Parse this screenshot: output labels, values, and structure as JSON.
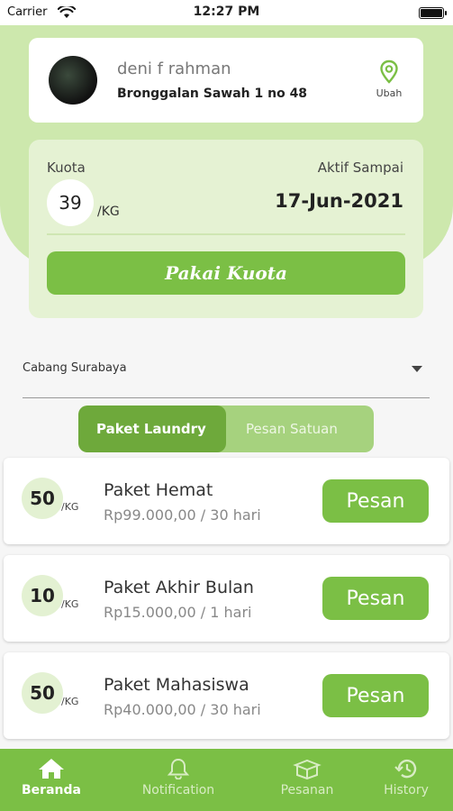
{
  "status_bar": {
    "carrier": "Carrier",
    "time": "12:27 PM"
  },
  "profile": {
    "name": "deni f rahman",
    "address": "Bronggalan Sawah 1 no 48",
    "location_label": "Ubah"
  },
  "quota": {
    "label": "Kuota",
    "value": "39",
    "unit": "/KG",
    "active_label": "Aktif Sampai",
    "active_date": "17-Jun-2021",
    "button_label": "Pakai Kuota"
  },
  "branch": {
    "selected": "Cabang Surabaya"
  },
  "tabs": [
    {
      "label": "Paket Laundry",
      "active": true
    },
    {
      "label": "Pesan Satuan",
      "active": false
    }
  ],
  "packages": [
    {
      "kg": "50",
      "unit": "/KG",
      "name": "Paket Hemat",
      "price": "Rp99.000,00 / 30 hari",
      "button": "Pesan"
    },
    {
      "kg": "10",
      "unit": "/KG",
      "name": "Paket Akhir Bulan",
      "price": "Rp15.000,00 / 1 hari",
      "button": "Pesan"
    },
    {
      "kg": "50",
      "unit": "/KG",
      "name": "Paket Mahasiswa",
      "price": "Rp40.000,00 / 30 hari",
      "button": "Pesan"
    }
  ],
  "bottom_nav": [
    {
      "label": "Beranda",
      "icon": "home-icon",
      "active": true
    },
    {
      "label": "Notification",
      "icon": "bell-icon",
      "active": false
    },
    {
      "label": "Pesanan",
      "icon": "box-icon",
      "active": false
    },
    {
      "label": "History",
      "icon": "history-icon",
      "active": false
    }
  ],
  "colors": {
    "primary_green": "#7bbf45",
    "light_green": "#cde8ad",
    "card_green": "#e5f2d3"
  }
}
